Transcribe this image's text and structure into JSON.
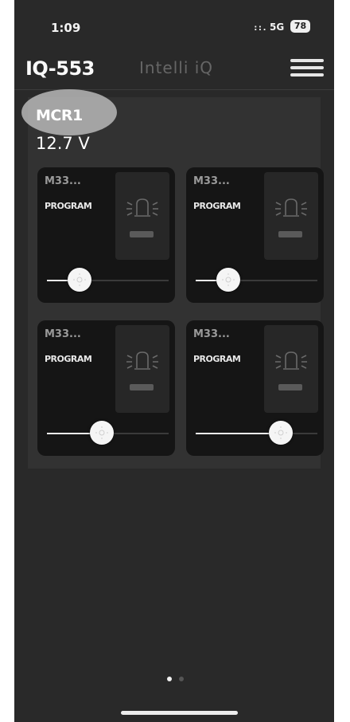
{
  "status_bar": {
    "time": "1:09",
    "signal": "::.",
    "network": "5G",
    "battery": "78"
  },
  "header": {
    "device_id": "IQ-553",
    "app_name": "Intelli iQ",
    "menu_icon": "hamburger-menu-icon"
  },
  "panel": {
    "module_name": "MCR1",
    "voltage": "12.7 V",
    "cards": [
      {
        "name": "M33...",
        "mode": "PROGRAM",
        "icon": "beacon-icon",
        "level": 0.27
      },
      {
        "name": "M33...",
        "mode": "PROGRAM",
        "icon": "beacon-icon",
        "level": 0.27
      },
      {
        "name": "M33...",
        "mode": "PROGRAM",
        "icon": "beacon-icon",
        "level": 0.45
      },
      {
        "name": "M33...",
        "mode": "PROGRAM",
        "icon": "beacon-icon",
        "level": 0.7
      }
    ]
  },
  "pager": {
    "pages": 2,
    "current": 1
  },
  "colors": {
    "background": "#292929",
    "panel": "#323232",
    "card": "#151515",
    "text": "#ffffff",
    "muted": "#666666"
  }
}
